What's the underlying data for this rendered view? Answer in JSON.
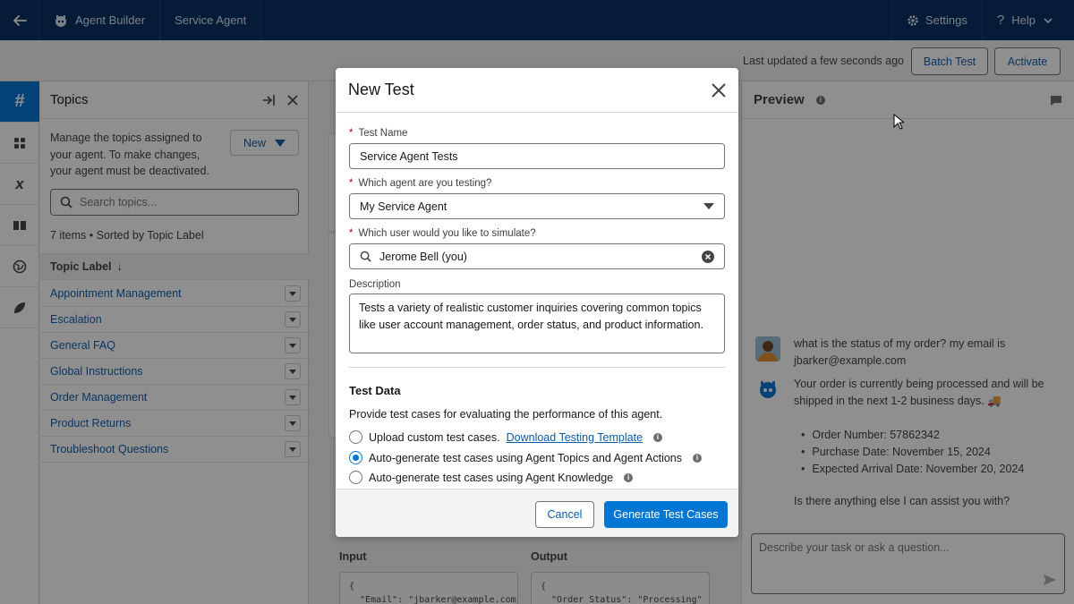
{
  "topnav": {
    "app_name": "Agent Builder",
    "agent_name": "Service Agent",
    "settings_label": "Settings",
    "help_label": "Help"
  },
  "subheader": {
    "updated_text": "Last updated a few seconds ago",
    "batch_test_label": "Batch Test",
    "activate_label": "Activate"
  },
  "topics": {
    "title": "Topics",
    "description": "Manage the topics assigned to your agent. To make changes, your agent must be deactivated.",
    "new_label": "New",
    "search_placeholder": "Search topics...",
    "count_text": "7 items • Sorted by Topic Label",
    "column_header": "Topic Label",
    "items": [
      {
        "label": "Appointment Management"
      },
      {
        "label": "Escalation"
      },
      {
        "label": "General FAQ"
      },
      {
        "label": "Global Instructions"
      },
      {
        "label": "Order Management"
      },
      {
        "label": "Product Returns"
      },
      {
        "label": "Troubleshoot Questions"
      }
    ]
  },
  "middle": {
    "input_label": "Input",
    "output_label": "Output",
    "input_code": "{\n  \"Email\": \"jbarker@example.com\"",
    "output_code": "{\n  \"Order_Status\": \"Processing\""
  },
  "preview": {
    "title": "Preview",
    "user_message": "what is the status of my order? my email is jbarker@example.com",
    "bot_message": "Your order is currently being processed and will be shipped in the next 1-2 business days. 🚚",
    "bullets": [
      "Order Number: 57862342",
      "Purchase Date: November 15, 2024",
      "Expected Arrival Date: November 20, 2024"
    ],
    "bot_followup": "Is there anything else I can assist you with?",
    "composer_placeholder": "Describe your task or ask a question..."
  },
  "modal": {
    "title": "New Test",
    "test_name_label": "Test Name",
    "test_name_value": "Service Agent Tests",
    "agent_label": "Which agent are you testing?",
    "agent_value": "My Service Agent",
    "user_label": "Which user would you like to simulate?",
    "user_value": "Jerome Bell (you)",
    "description_label": "Description",
    "description_value": "Tests a variety of realistic customer inquiries covering common topics like user account management, order status, and product information.",
    "test_data_title": "Test Data",
    "test_data_desc": "Provide test cases for evaluating the performance of this agent.",
    "option_upload": "Upload custom test cases.",
    "option_upload_link": "Download Testing Template",
    "option_autogen_actions": "Auto-generate test cases using Agent Topics and Agent Actions",
    "option_autogen_knowledge": "Auto-generate test cases using Agent Knowledge",
    "selected_option": "autogen_actions",
    "cancel_label": "Cancel",
    "generate_label": "Generate Test Cases"
  },
  "colors": {
    "nav_bg": "#032d60",
    "brand": "#0176d3",
    "link": "#0b5cab"
  }
}
